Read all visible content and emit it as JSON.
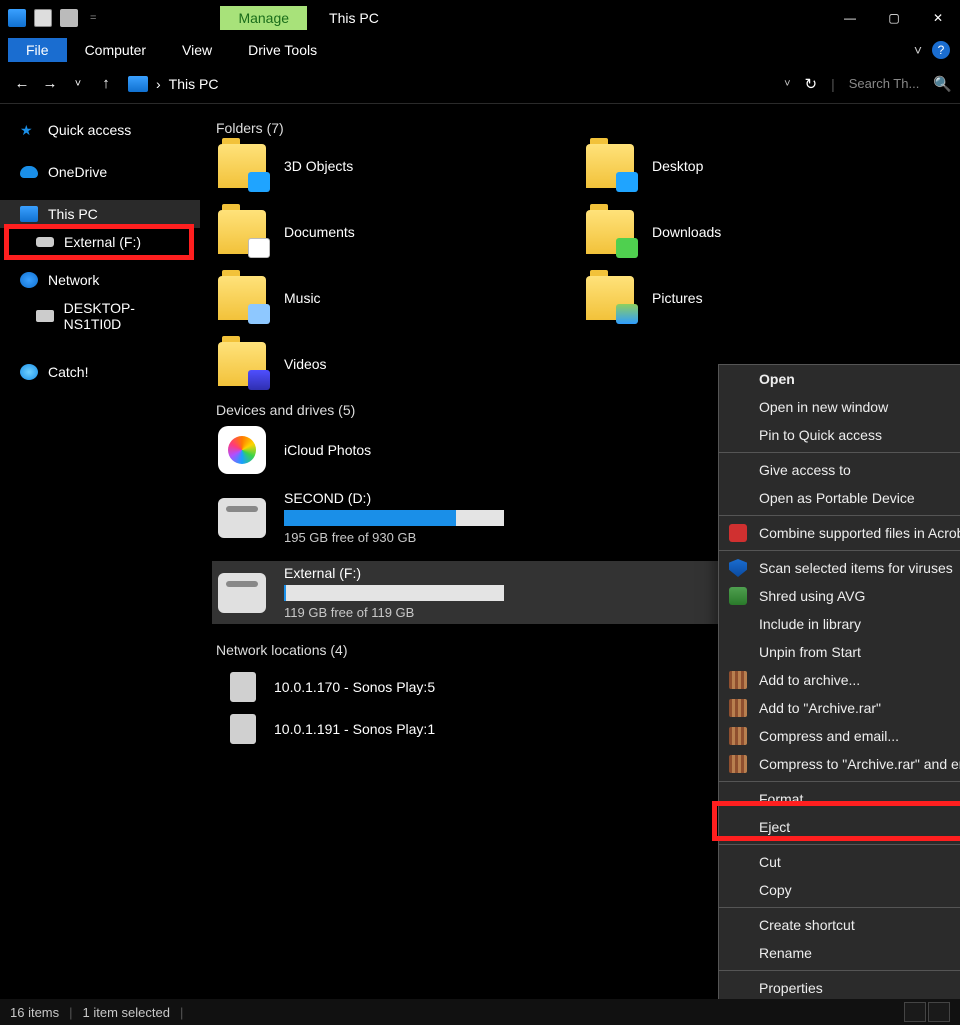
{
  "titlebar": {
    "qat_sep": "=",
    "manage": "Manage",
    "title": "This PC"
  },
  "ribbon": {
    "file": "File",
    "tabs": [
      "Computer",
      "View",
      "Drive Tools"
    ]
  },
  "address": {
    "crumb_sep": "›",
    "location": "This PC",
    "search_hint": "Search Th..."
  },
  "sidebar": {
    "quick_access": "Quick access",
    "onedrive": "OneDrive",
    "this_pc": "This PC",
    "external": "External (F:)",
    "network": "Network",
    "desktop_node": "DESKTOP-NS1TI0D",
    "catch": "Catch!"
  },
  "sections": {
    "folders": "Folders (7)",
    "devices": "Devices and drives (5)",
    "network": "Network locations (4)"
  },
  "folders": {
    "three_d": "3D Objects",
    "desktop": "Desktop",
    "documents": "Documents",
    "downloads": "Downloads",
    "music": "Music",
    "pictures": "Pictures",
    "videos": "Videos"
  },
  "drives": {
    "icloud": "iCloud Photos",
    "second": {
      "label": "SECOND (D:)",
      "free": "195 GB free of 930 GB",
      "pct": 78
    },
    "external": {
      "label": "External (F:)",
      "free": "119 GB free of 119 GB",
      "pct": 1
    }
  },
  "network_locations": {
    "sonos5": "10.0.1.170 - Sonos Play:5",
    "sonos1": "10.0.1.191 - Sonos Play:1"
  },
  "context_menu": {
    "open": "Open",
    "open_new": "Open in new window",
    "pin_quick": "Pin to Quick access",
    "give_access": "Give access to",
    "open_portable": "Open as Portable Device",
    "combine_acrobat": "Combine supported files in Acrobat...",
    "scan_viruses": "Scan selected items for viruses",
    "shred_avg": "Shred using AVG",
    "include_library": "Include in library",
    "unpin_start": "Unpin from Start",
    "add_archive": "Add to archive...",
    "add_archive_rar": "Add to \"Archive.rar\"",
    "compress_email": "Compress and email...",
    "compress_rar_email": "Compress to \"Archive.rar\" and email",
    "format": "Format...",
    "eject": "Eject",
    "cut": "Cut",
    "copy": "Copy",
    "create_shortcut": "Create shortcut",
    "rename": "Rename",
    "properties": "Properties"
  },
  "status": {
    "items": "16 items",
    "selected": "1 item selected"
  }
}
